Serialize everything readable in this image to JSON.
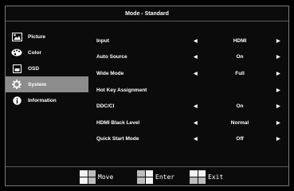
{
  "title": "Mode - Standard",
  "sidebar": {
    "items": [
      {
        "label": "Picture",
        "icon": "picture-icon",
        "active": false
      },
      {
        "label": "Color",
        "icon": "palette-icon",
        "active": false
      },
      {
        "label": "OSD",
        "icon": "osd-icon",
        "active": false
      },
      {
        "label": "System",
        "icon": "gear-icon",
        "active": true
      },
      {
        "label": "Information",
        "icon": "info-icon",
        "active": false
      }
    ]
  },
  "menu": {
    "rows": [
      {
        "label": "Input",
        "value": "HDMI"
      },
      {
        "label": "Auto Source",
        "value": "On"
      },
      {
        "label": "Wide Mode",
        "value": "Full"
      },
      {
        "label": "Hot Key Assignment",
        "value": ""
      },
      {
        "label": "DDC/CI",
        "value": "On"
      },
      {
        "label": "HDMI Black Level",
        "value": "Normal"
      },
      {
        "label": "Quick Start Mode",
        "value": "Off"
      }
    ]
  },
  "footer": {
    "move_label": "Move",
    "enter_label": "Enter",
    "exit_label": "Exit"
  },
  "colors": {
    "active_bg": "#8c8c8c",
    "border": "#7a7a7a"
  }
}
